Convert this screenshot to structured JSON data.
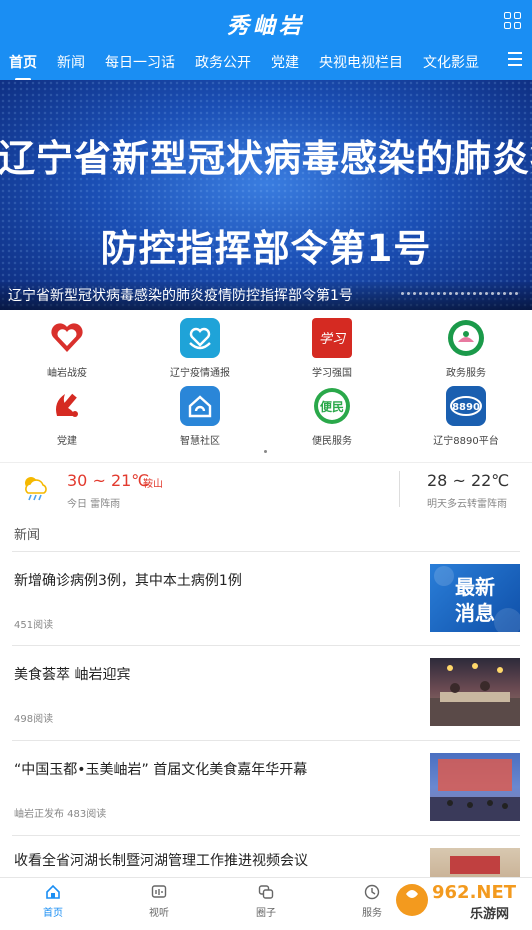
{
  "header": {
    "app_title": "秀岫岩",
    "tabs": [
      {
        "label": "首页",
        "active": true
      },
      {
        "label": "新闻"
      },
      {
        "label": "每日一习话"
      },
      {
        "label": "政务公开"
      },
      {
        "label": "党建"
      },
      {
        "label": "央视电视栏目"
      },
      {
        "label": "文化影显"
      }
    ],
    "menu_icon": "hamburger-icon",
    "grid_icon": "grid-icon"
  },
  "banner": {
    "line1": "辽宁省新型冠状病毒感染的肺炎疫情",
    "line2": "防控指挥部令第1号",
    "caption": "辽宁省新型冠状病毒感染的肺炎疫情防控指挥部令第1号"
  },
  "services": [
    {
      "label": "岫岩战疫",
      "icon": "heart-icon",
      "color": "#d9302c"
    },
    {
      "label": "辽宁疫情通报",
      "icon": "heart-hands-icon",
      "color": "#1fa3d8"
    },
    {
      "label": "学习强国",
      "icon": "xuexi-icon",
      "color": "#d52a22"
    },
    {
      "label": "政务服务",
      "icon": "gov-service-icon",
      "color": "#1b9a4a"
    },
    {
      "label": "党建",
      "icon": "party-emblem-icon",
      "color": "#d52a22"
    },
    {
      "label": "智慧社区",
      "icon": "smart-community-icon",
      "color": "#2a86d8"
    },
    {
      "label": "便民服务",
      "icon": "convenience-icon",
      "color": "#2aa84a"
    },
    {
      "label": "辽宁8890平台",
      "icon": "platform-8890-icon",
      "color": "#1a5fb0"
    }
  ],
  "weather": {
    "today_temp": "30 ~ 21℃",
    "city": "鞍山",
    "today_desc": "今日 雷阵雨",
    "tomorrow_temp": "28 ~ 22℃",
    "tomorrow_desc": "明天多云转雷阵雨",
    "icon": "thunderstorm-icon"
  },
  "news": {
    "section_title": "新闻",
    "items": [
      {
        "title": "新增确诊病例3例，其中本土病例1例",
        "meta": "451阅读",
        "image": "latest-news-thumb"
      },
      {
        "title": "美食荟萃 岫岩迎宾",
        "meta": "498阅读",
        "image": "food-event-thumb"
      },
      {
        "title": "“中国玉都•玉美岫岩” 首届文化美食嘉年华开幕",
        "meta": "岫岩正发布 483阅读",
        "image": "stage-thumb"
      },
      {
        "title": "收看全省河湖长制暨河湖管理工作推进视频会议",
        "meta": "",
        "image": "meeting-thumb"
      }
    ],
    "thumb_text": "最新\n消息"
  },
  "bottom_nav": [
    {
      "label": "首页",
      "icon": "home-icon",
      "active": true
    },
    {
      "label": "视听",
      "icon": "audio-visual-icon"
    },
    {
      "label": "圈子",
      "icon": "circle-chat-icon"
    },
    {
      "label": "服务",
      "icon": "clock-service-icon"
    }
  ],
  "watermark": {
    "text1": "962.NET",
    "text2": "乐游网"
  }
}
